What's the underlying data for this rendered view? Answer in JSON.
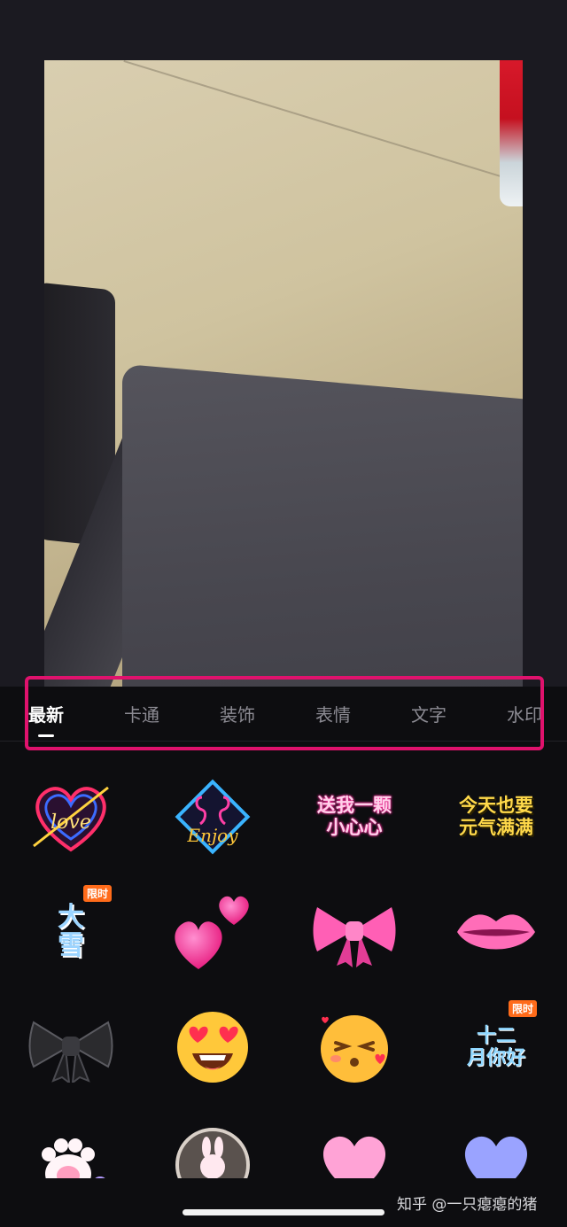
{
  "tabs": [
    "最新",
    "卡通",
    "装饰",
    "表情",
    "文字",
    "水印"
  ],
  "active_tab": "最新",
  "stickers": {
    "s3_text_line1": "送我一颗",
    "s3_text_line2": "小心心",
    "s4_text_line1": "今天也要",
    "s4_text_line2": "元气满满",
    "s5_text_line1": "大",
    "s5_text_line2": "雪",
    "s5_badge": "限时",
    "s12_text_line1": "十二",
    "s12_text_line2": "月你好",
    "s12_badge": "限时",
    "s2_text": "Enjoy",
    "s1_text": "love"
  },
  "watermark": "知乎 @一只瘪瘪的猪",
  "colors": {
    "highlight": "#e0126d",
    "badge": "#ff6b1a",
    "panel_bg": "#0d0d10"
  }
}
